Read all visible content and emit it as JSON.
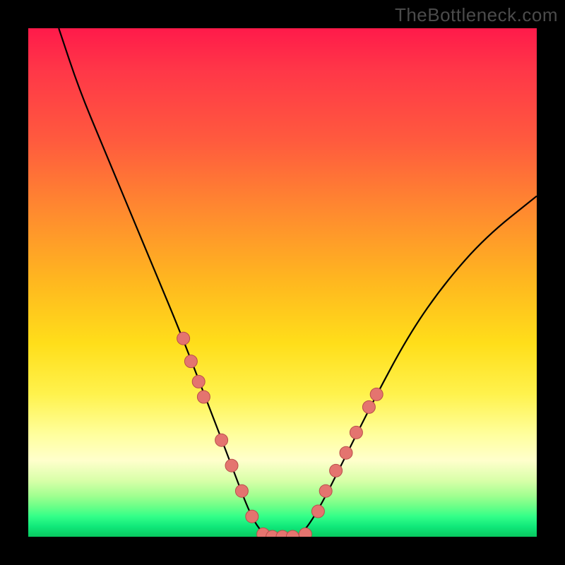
{
  "watermark": "TheBottleneck.com",
  "chart_data": {
    "type": "line",
    "title": "",
    "xlabel": "",
    "ylabel": "",
    "xlim": [
      0,
      100
    ],
    "ylim": [
      0,
      100
    ],
    "grid": false,
    "legend": false,
    "series": [
      {
        "name": "bottleneck-curve",
        "x": [
          6,
          10,
          15,
          20,
          25,
          30,
          35,
          40,
          43,
          45,
          47,
          50,
          53,
          55,
          58,
          62,
          68,
          75,
          82,
          90,
          100
        ],
        "y": [
          100,
          88,
          76,
          64,
          52,
          40,
          27,
          14,
          6,
          2,
          0,
          0,
          0,
          2,
          7,
          15,
          27,
          40,
          50,
          59,
          67
        ]
      }
    ],
    "flat_region": {
      "x_start": 47,
      "x_end": 55,
      "y": 0
    },
    "markers": {
      "name": "highlighted-points",
      "points": [
        {
          "x": 30.5,
          "y": 39
        },
        {
          "x": 32.0,
          "y": 34.5
        },
        {
          "x": 33.5,
          "y": 30.5
        },
        {
          "x": 34.5,
          "y": 27.5
        },
        {
          "x": 38.0,
          "y": 19
        },
        {
          "x": 40.0,
          "y": 14
        },
        {
          "x": 42.0,
          "y": 9
        },
        {
          "x": 44.0,
          "y": 4
        },
        {
          "x": 46.2,
          "y": 0.5
        },
        {
          "x": 48.0,
          "y": 0
        },
        {
          "x": 50.0,
          "y": 0
        },
        {
          "x": 52.0,
          "y": 0
        },
        {
          "x": 54.5,
          "y": 0.5
        },
        {
          "x": 57.0,
          "y": 5
        },
        {
          "x": 58.5,
          "y": 9
        },
        {
          "x": 60.5,
          "y": 13
        },
        {
          "x": 62.5,
          "y": 16.5
        },
        {
          "x": 64.5,
          "y": 20.5
        },
        {
          "x": 67.0,
          "y": 25.5
        },
        {
          "x": 68.5,
          "y": 28
        }
      ]
    },
    "gradient_bands": [
      {
        "y": 100,
        "color": "#ff1a4a"
      },
      {
        "y": 50,
        "color": "#ffde1a"
      },
      {
        "y": 15,
        "color": "#ffffcc"
      },
      {
        "y": 0,
        "color": "#08c85f"
      }
    ]
  }
}
